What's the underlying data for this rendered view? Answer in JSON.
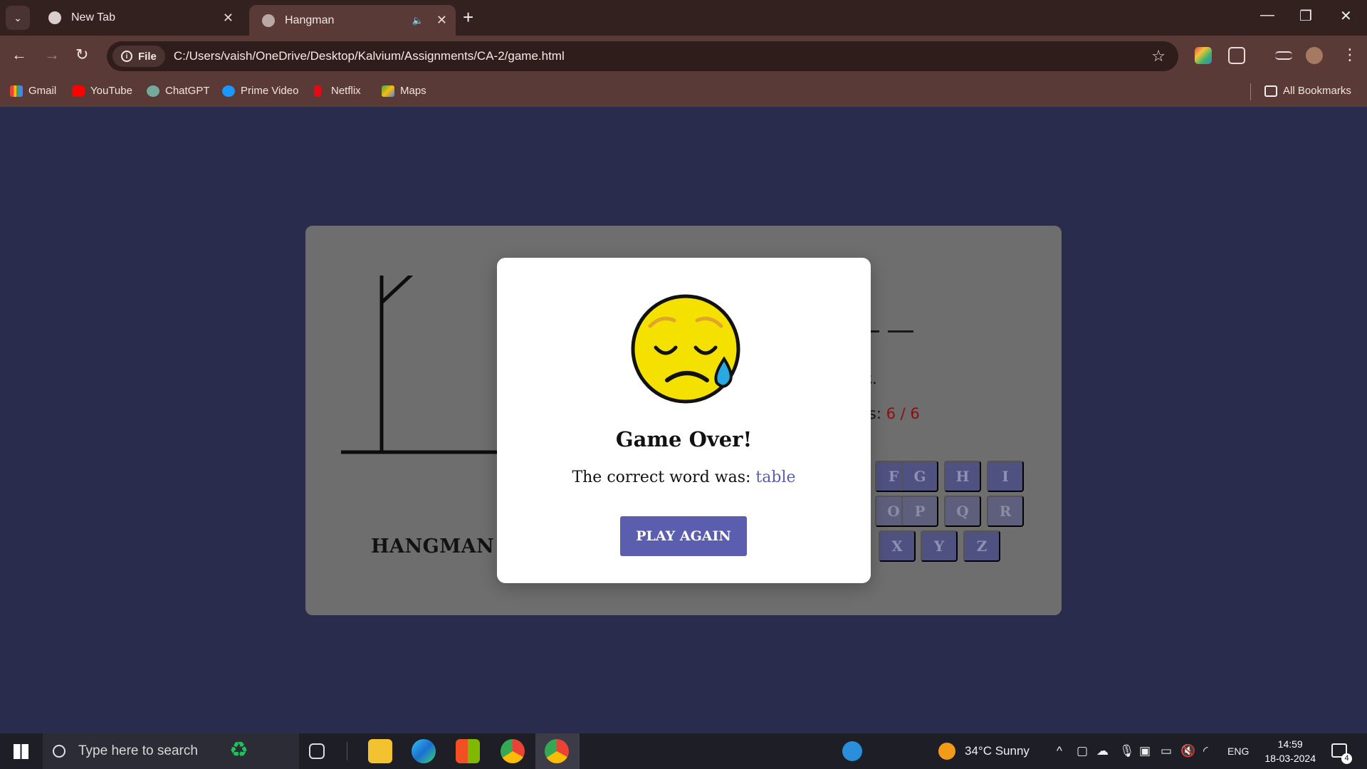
{
  "browser": {
    "tabs": [
      {
        "title": "New Tab",
        "active": false
      },
      {
        "title": "Hangman",
        "active": true
      }
    ],
    "url_chip": "File",
    "url": "C:/Users/vaish/OneDrive/Desktop/Kalvium/Assignments/CA-2/game.html",
    "bookmarks": [
      "Gmail",
      "YouTube",
      "ChatGPT",
      "Prime Video",
      "Netflix",
      "Maps"
    ],
    "all_bookmarks": "All Bookmarks"
  },
  "game": {
    "title": "HANGMAN GAME",
    "hint_fragment": "it.",
    "guesses_label": "es: ",
    "guesses_count": "6 / 6",
    "keys_row1": [
      "F",
      "G",
      "H",
      "I"
    ],
    "keys_row2": [
      "O",
      "P",
      "Q",
      "R"
    ],
    "keys_row3": [
      "X",
      "Y",
      "Z"
    ]
  },
  "modal": {
    "title": "Game Over!",
    "message": "The correct word was: ",
    "word": "table",
    "button": "PLAY AGAIN"
  },
  "taskbar": {
    "search_placeholder": "Type here to search",
    "weather": "34°C  Sunny",
    "language": "ENG",
    "time": "14:59",
    "date": "18-03-2024",
    "notifications": "4"
  },
  "colors": {
    "page_bg": "#2a2c4d",
    "accent": "#5b5eae",
    "danger": "#8b0f0f"
  }
}
